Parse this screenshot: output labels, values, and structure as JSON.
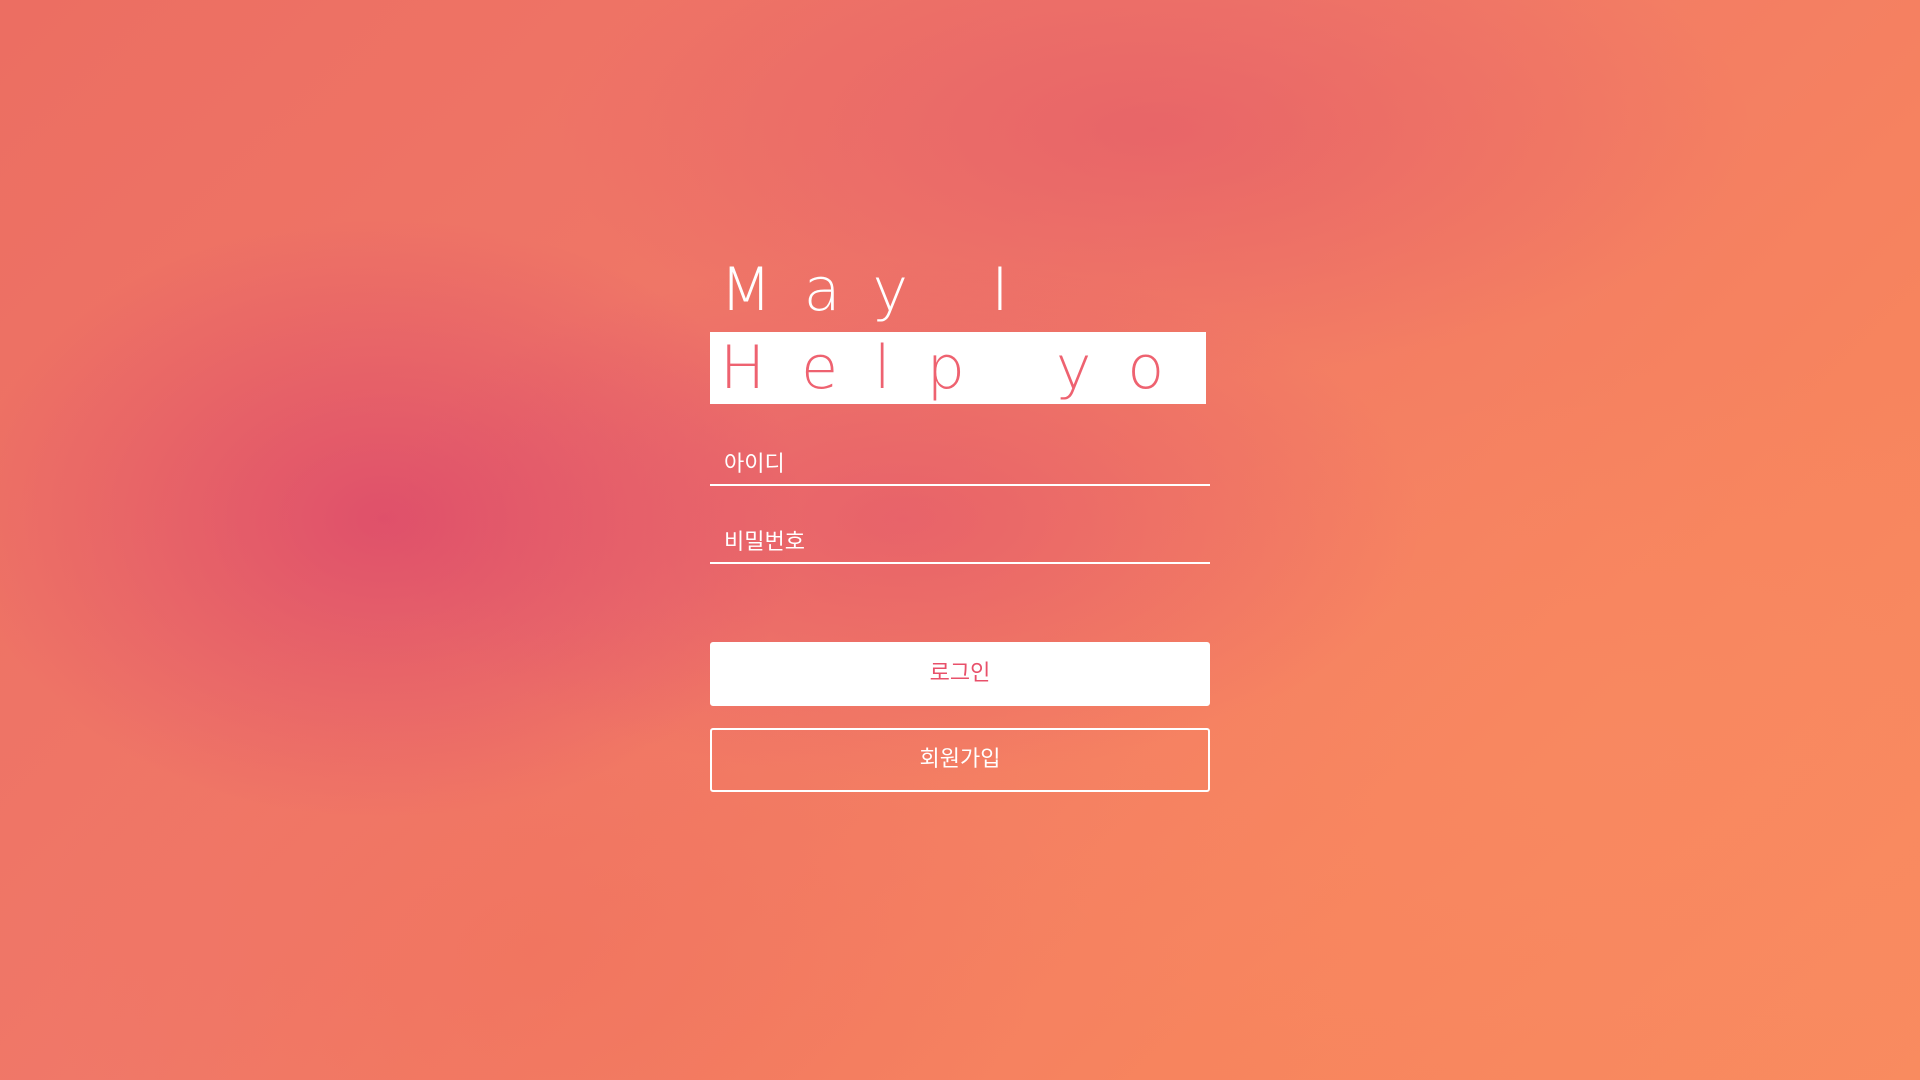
{
  "headline": {
    "line1": "May I",
    "line2": "Help you?"
  },
  "form": {
    "id_placeholder": "아이디",
    "password_placeholder": "비밀번호",
    "login_label": "로그인",
    "signup_label": "회원가입"
  },
  "colors": {
    "background_accent": "#f47a5e",
    "headline_highlight_text": "#ee6270",
    "login_text": "#e8506a",
    "foreground": "#ffffff"
  }
}
